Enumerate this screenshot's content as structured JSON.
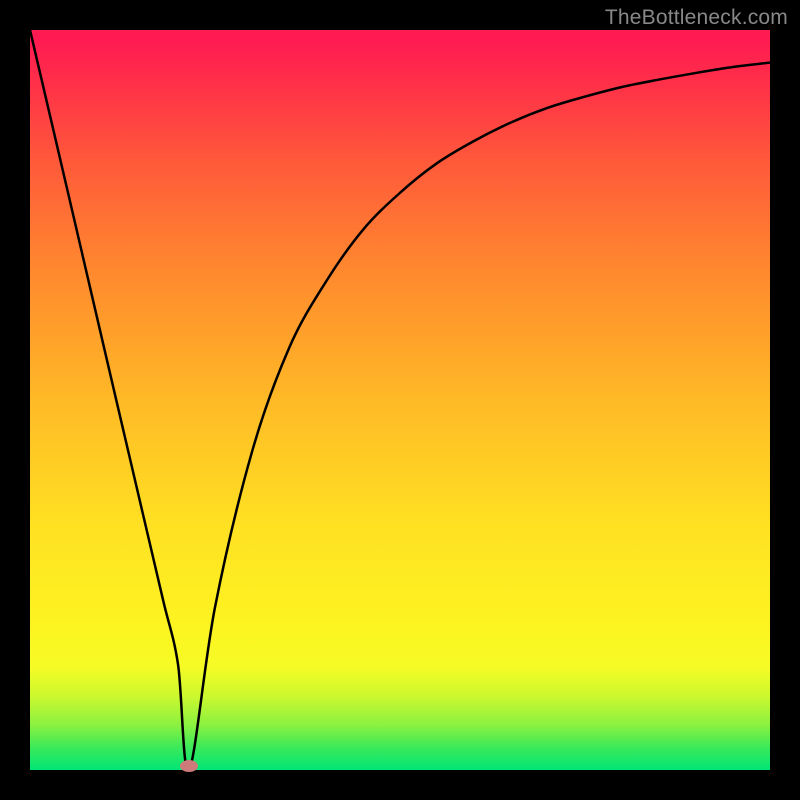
{
  "watermark": "TheBottleneck.com",
  "chart_data": {
    "type": "line",
    "title": "",
    "xlabel": "",
    "ylabel": "",
    "xlim": [
      0,
      100
    ],
    "ylim": [
      0,
      100
    ],
    "series": [
      {
        "name": "bottleneck-curve",
        "x": [
          0,
          5,
          10,
          15,
          18,
          20,
          21.5,
          25,
          30,
          35,
          40,
          45,
          50,
          55,
          60,
          65,
          70,
          75,
          80,
          85,
          90,
          95,
          100
        ],
        "y": [
          100,
          78.6,
          57.1,
          35.7,
          22.9,
          14.3,
          0,
          22,
          43,
          57,
          66,
          73,
          78,
          82,
          85,
          87.5,
          89.5,
          91,
          92.3,
          93.3,
          94.2,
          95,
          95.6
        ]
      }
    ],
    "marker": {
      "x": 21.5,
      "y": 0,
      "color": "#cc7a7a"
    },
    "background_gradient": {
      "stops": [
        {
          "pos": 0,
          "color": "#ff1a52"
        },
        {
          "pos": 50,
          "color": "#ffb926"
        },
        {
          "pos": 80,
          "color": "#fdf321"
        },
        {
          "pos": 100,
          "color": "#00e676"
        }
      ]
    }
  }
}
